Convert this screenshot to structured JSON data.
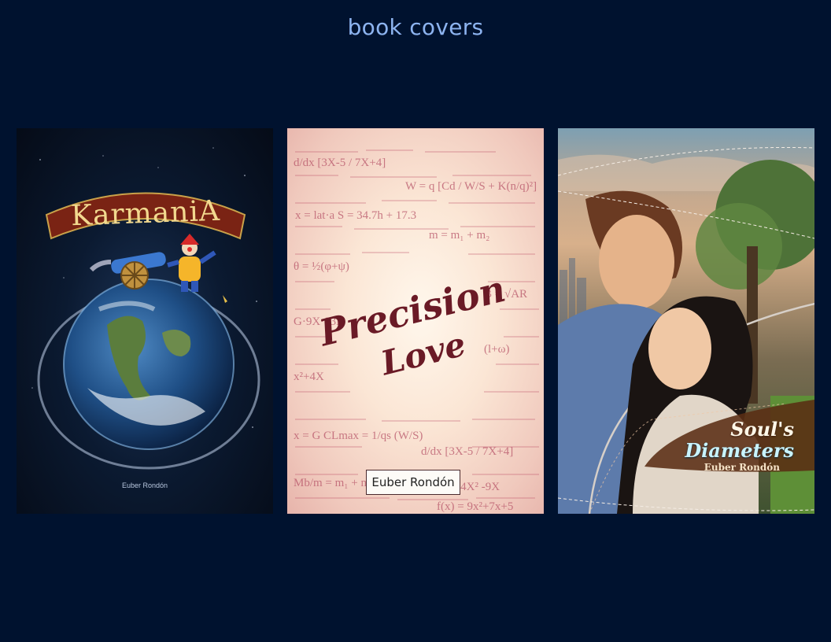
{
  "page": {
    "title": "book covers"
  },
  "covers": [
    {
      "title": "KarmaniA",
      "author": "Euber Rondón"
    },
    {
      "title_line1": "Precision",
      "title_line2": "Love",
      "author": "Euber Rondón"
    },
    {
      "title_line1": "Soul's",
      "title_line2": "Diameters",
      "author": "Euber Rondón"
    }
  ],
  "colors": {
    "background": "#00122f",
    "title": "#8db4f0"
  }
}
